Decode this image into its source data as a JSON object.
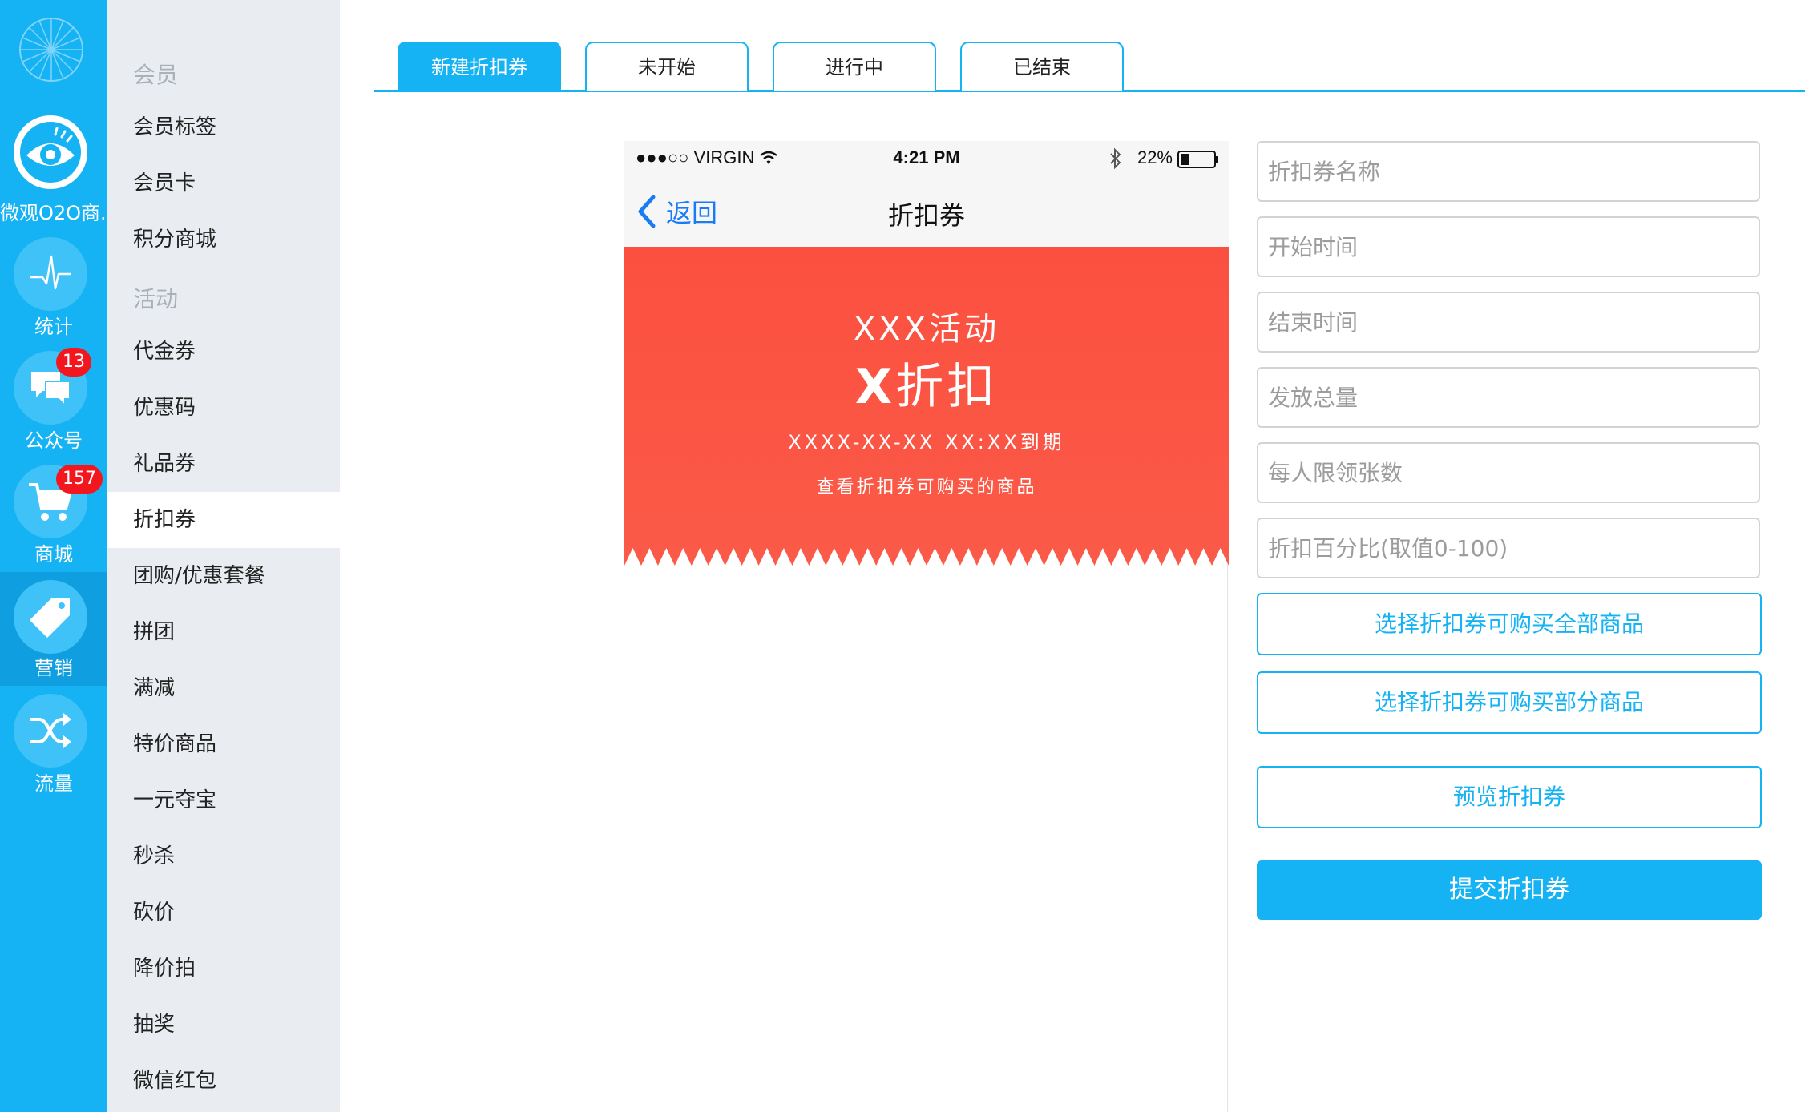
{
  "rail": {
    "logo_icon": "wheel-logo-icon",
    "items": [
      {
        "label": "微观O2O商...",
        "icon": "eye-icon"
      },
      {
        "label": "统计",
        "icon": "pulse-icon"
      },
      {
        "label": "公众号",
        "icon": "chat-icon",
        "badge": "13"
      },
      {
        "label": "商城",
        "icon": "cart-icon",
        "badge": "157"
      },
      {
        "label": "营销",
        "icon": "tag-icon"
      },
      {
        "label": "流量",
        "icon": "shuffle-icon"
      }
    ]
  },
  "submenu": {
    "groups": [
      "会员",
      "活动"
    ],
    "items": [
      "会员标签",
      "会员卡",
      "积分商城",
      "代金券",
      "优惠码",
      "礼品券",
      "折扣券",
      "团购/优惠套餐",
      "拼团",
      "满减",
      "特价商品",
      "一元夺宝",
      "秒杀",
      "砍价",
      "降价拍",
      "抽奖",
      "微信红包"
    ],
    "active": "折扣券"
  },
  "tabs": [
    "新建折扣券",
    "未开始",
    "进行中",
    "已结束"
  ],
  "phone": {
    "carrier": "●●●○○ VIRGIN",
    "time": "4:21 PM",
    "battery": "22%",
    "back_label": "返回",
    "title": "折扣券",
    "coupon": {
      "event": "XXX活动",
      "discount_x": "X",
      "discount_text": "折扣",
      "expire": "XXXX-XX-XX XX:XX到期",
      "link": "查看折扣券可购买的商品"
    }
  },
  "form": {
    "fields": [
      "折扣券名称",
      "开始时间",
      "结束时间",
      "发放总量",
      "每人限领张数",
      "折扣百分比(取值0-100)"
    ],
    "buttons": {
      "all_goods": "选择折扣券可购买全部商品",
      "some_goods": "选择折扣券可购买部分商品",
      "preview": "预览折扣券",
      "submit": "提交折扣券"
    }
  },
  "colors": {
    "primary": "#16b3f4",
    "coupon": "#fb5443",
    "badge": "#f4161e",
    "ios_blue": "#1a7cf4"
  }
}
